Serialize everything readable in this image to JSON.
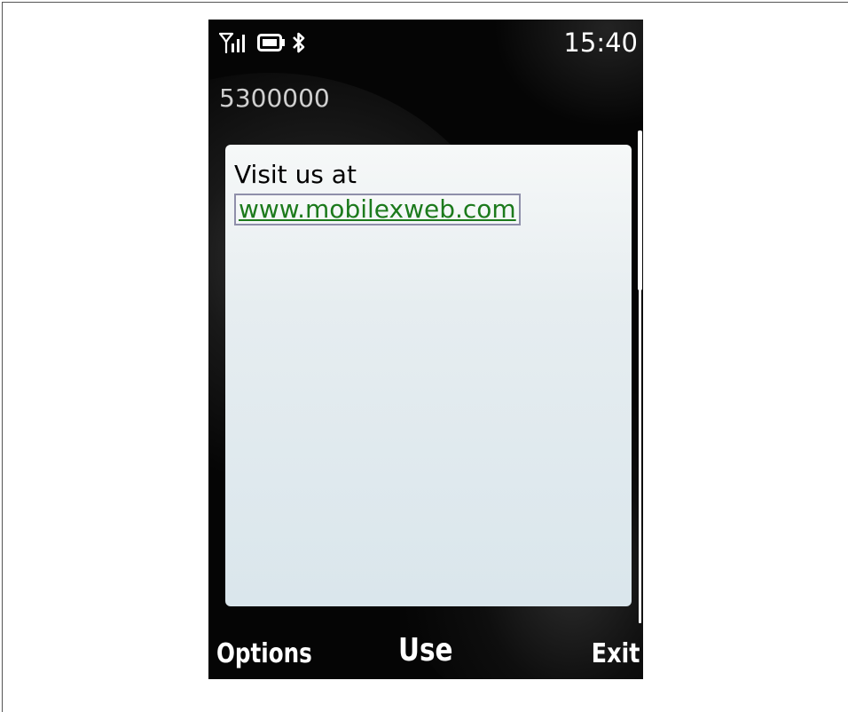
{
  "status_bar": {
    "signal_icon": "signal-strength-icon",
    "battery_icon": "battery-icon",
    "bluetooth_icon": "bluetooth-icon",
    "time": "15:40"
  },
  "message": {
    "sender": "5300000",
    "body_text": "Visit us at",
    "link_text": "www.mobilexweb.com"
  },
  "softkeys": {
    "left": "Options",
    "middle": "Use",
    "right": "Exit"
  },
  "colors": {
    "screen_background": "#050505",
    "panel_top": "#f6f8f8",
    "panel_bottom": "#dae6ec",
    "link": "#1c7a1c",
    "link_focus_border": "#8f8faa"
  }
}
